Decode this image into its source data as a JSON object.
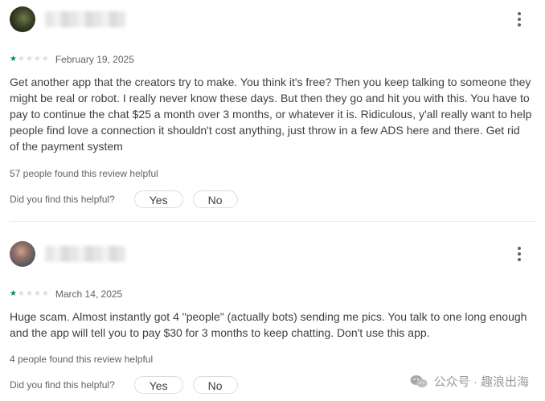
{
  "reviews": [
    {
      "rating": 1,
      "date": "February 19, 2025",
      "text": "Get another app that the creators try to make. You think it's free? Then you keep talking to someone they might be real or robot. I really never know these days. But then they go and hit you with this. You have to pay to continue the chat $25 a month over 3 months, or whatever it is. Ridiculous, y'all really want to help people find love a connection it shouldn't cost anything, just throw in a few ADS here and there. Get rid of the payment system",
      "helpful_count": "57 people found this review helpful",
      "prompt": "Did you find this helpful?",
      "yes_label": "Yes",
      "no_label": "No"
    },
    {
      "rating": 1,
      "date": "March 14, 2025",
      "text": "Huge scam. Almost instantly got 4 \"people\" (actually bots) sending me pics. You talk to one long enough and the app will tell you to pay $30 for 3 months to keep chatting. Don't use this app.",
      "helpful_count": "4 people found this review helpful",
      "prompt": "Did you find this helpful?",
      "yes_label": "Yes",
      "no_label": "No"
    }
  ],
  "watermark": "公众号 · 趣浪出海",
  "colors": {
    "star_filled": "#01875f",
    "star_empty": "#dadce0"
  }
}
